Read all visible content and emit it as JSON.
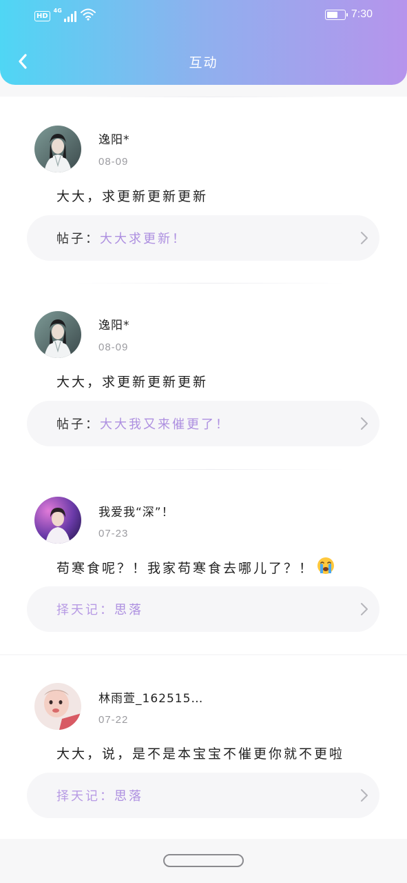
{
  "status_bar": {
    "hd": "HD",
    "network": "4G",
    "time": "7:30"
  },
  "header": {
    "title": "互动",
    "back_icon": "chevron-left-icon"
  },
  "items": [
    {
      "username": "逸阳*",
      "date": "08-09",
      "comment": "大大，求更新更新更新",
      "post_prefix": "帖子：",
      "post_title": "大大求更新！"
    },
    {
      "username": "逸阳*",
      "date": "08-09",
      "comment": "大大，求更新更新更新",
      "post_prefix": "帖子：",
      "post_title": "大大我又来催更了！"
    },
    {
      "username": "我爱我“深”！",
      "date": "07-23",
      "comment": "苟寒食呢？！我家苟寒食去哪儿了？！",
      "comment_emoji": "crying-face-icon",
      "post_prefix": "择天记：",
      "post_title": "思落"
    },
    {
      "username": "林雨萱_162515…",
      "date": "07-22",
      "comment": "大大，说，是不是本宝宝不催更你就不更啦",
      "post_prefix": "择天记：",
      "post_title": "思落"
    }
  ],
  "colors": {
    "header_start": "#4fd6f4",
    "header_end": "#b694ec",
    "accent_purple": "#ad8fe0",
    "date_gray": "#9b9ba0"
  }
}
